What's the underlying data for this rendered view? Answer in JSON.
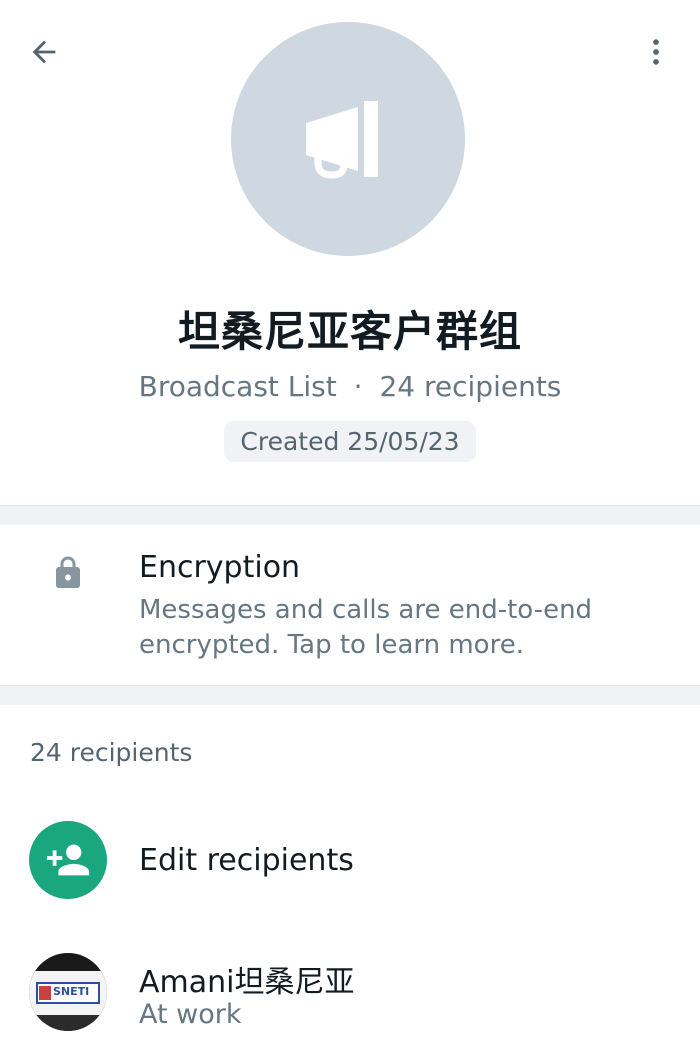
{
  "header": {
    "group_name": "坦桑尼亚客户群组",
    "type_label": "Broadcast List",
    "separator": "·",
    "recipients_label": "24 recipients",
    "created": "Created 25/05/23"
  },
  "encryption": {
    "title": "Encryption",
    "description": "Messages and calls are end-to-end encrypted. Tap to learn more."
  },
  "recipients": {
    "count_label": "24 recipients",
    "edit_label": "Edit recipients",
    "items": [
      {
        "name": "Amani坦桑尼亚",
        "status": "At work",
        "avatar_text": "SNETI"
      }
    ]
  },
  "colors": {
    "accent": "#1aa77f",
    "avatar_bg": "#cfd8e0",
    "secondary_text": "#667781",
    "divider": "#f0f2f5"
  },
  "icons": {
    "back": "arrow-left-icon",
    "menu": "more-vert-icon",
    "broadcast": "megaphone-icon",
    "lock": "lock-icon",
    "add_person": "person-add-icon"
  }
}
